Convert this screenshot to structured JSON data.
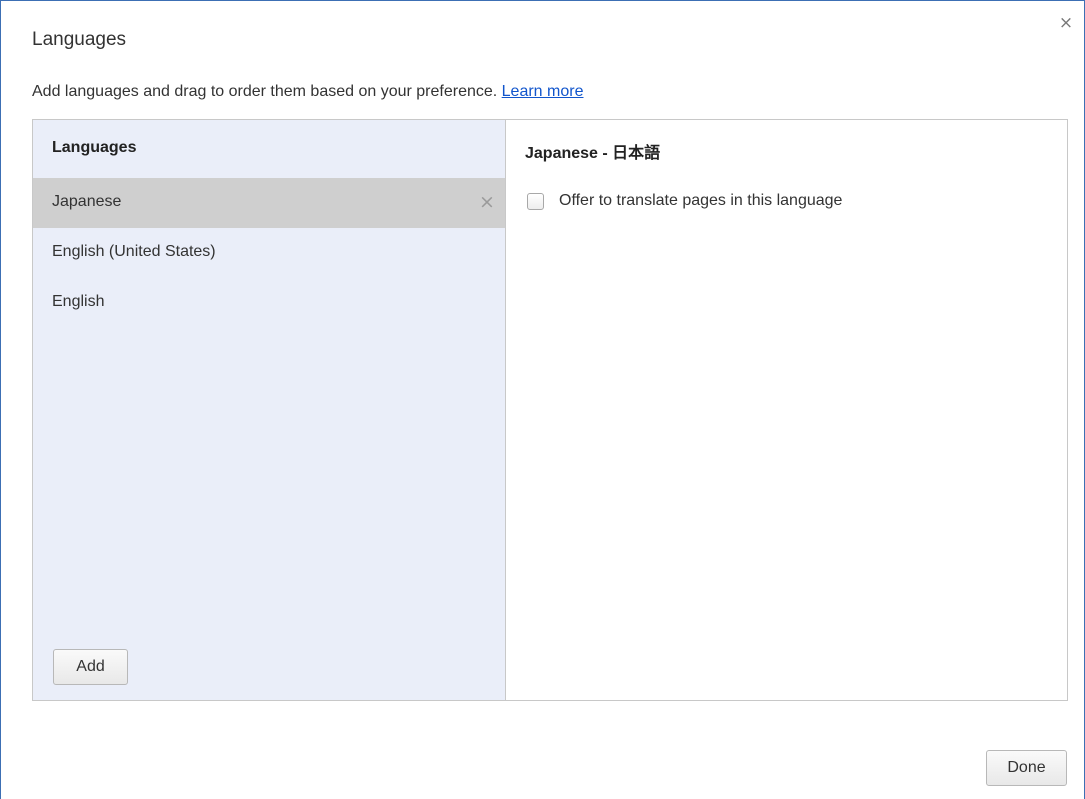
{
  "dialog": {
    "title": "Languages",
    "close_glyph": "×",
    "description": "Add languages and drag to order them based on your preference.",
    "learn_more_link": "Learn more",
    "done_label": "Done"
  },
  "languages_panel": {
    "header": "Languages",
    "items": [
      {
        "label": "Japanese",
        "selected": true,
        "remove_glyph": "×"
      },
      {
        "label": "English (United States)",
        "selected": false
      },
      {
        "label": "English",
        "selected": false
      }
    ],
    "add_label": "Add"
  },
  "details_panel": {
    "header": "Japanese - 日本語",
    "translate_option": {
      "label": "Offer to translate pages in this language",
      "checked": false
    }
  },
  "colors": {
    "link": "#1155cc",
    "list_background": "#eaeef9",
    "selected_row": "#cfcfcf",
    "window_border": "#3c6fb4"
  }
}
